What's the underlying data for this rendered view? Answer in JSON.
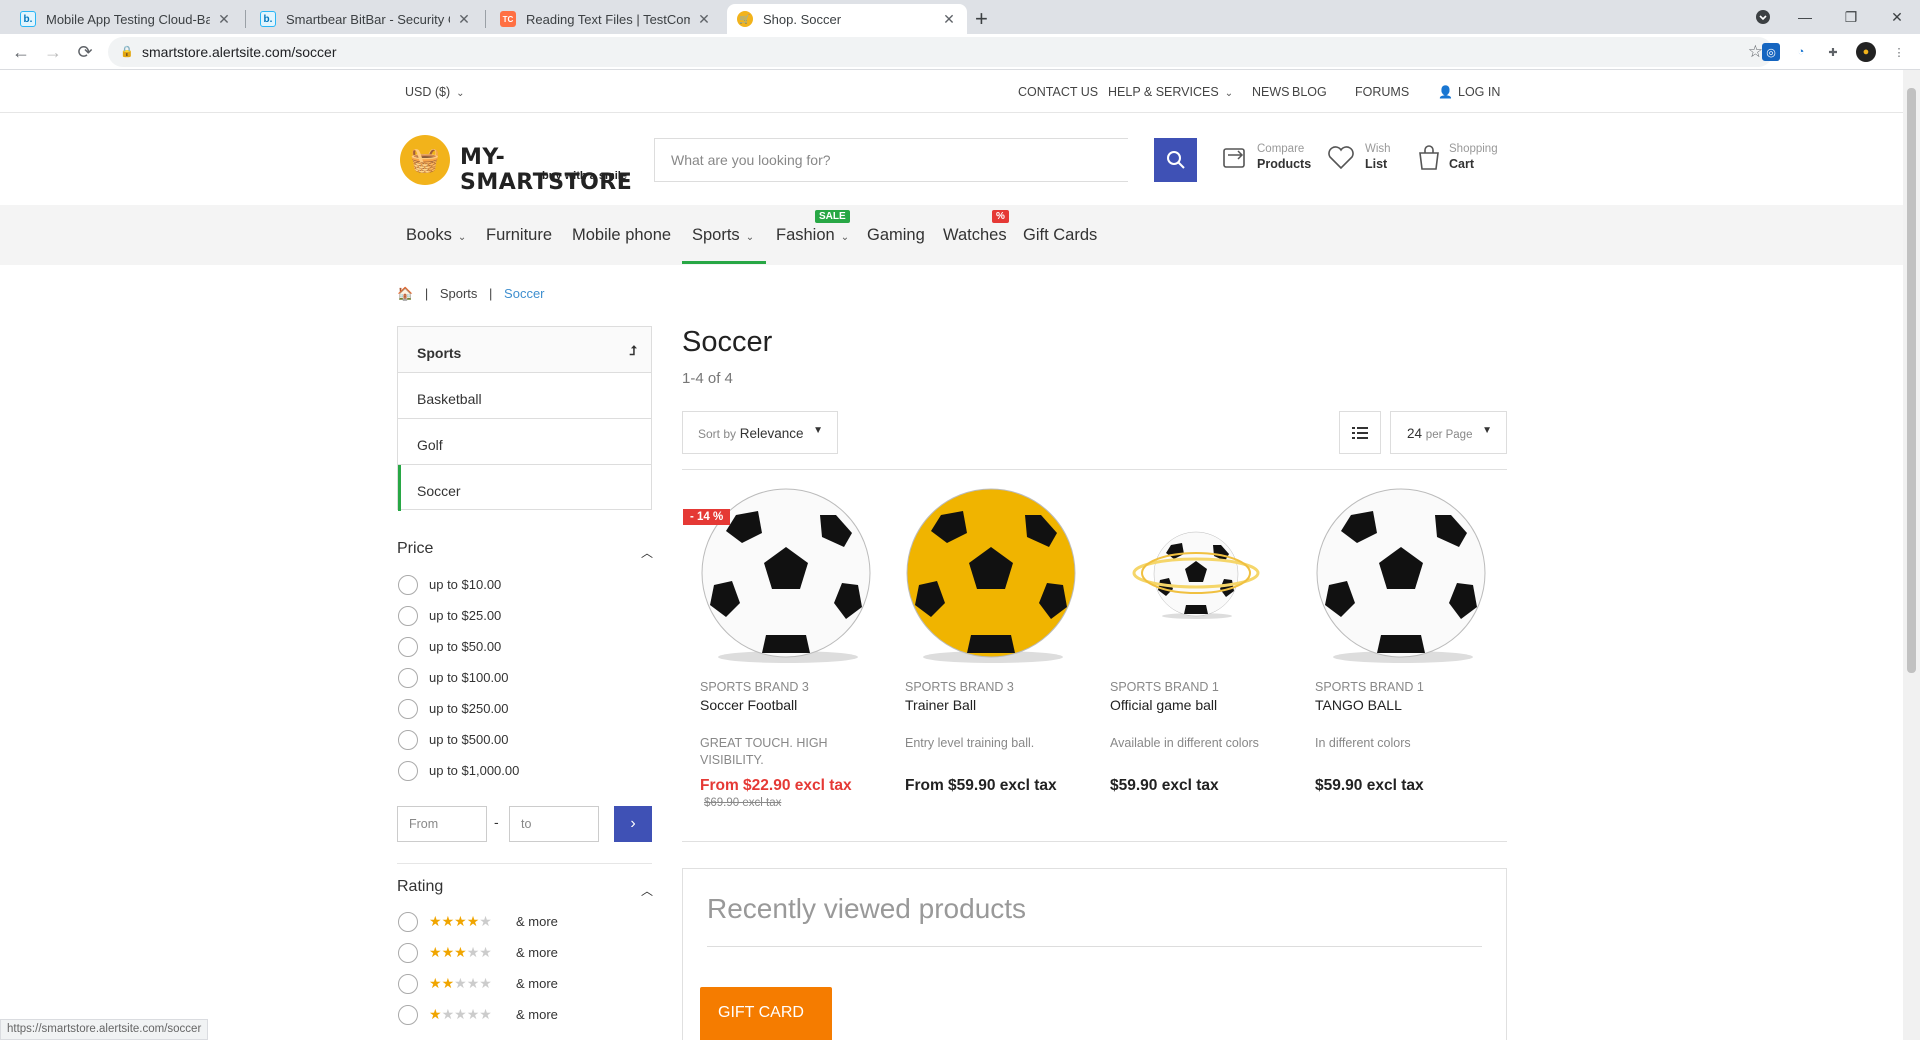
{
  "browser": {
    "tabs": [
      {
        "title": "Mobile App Testing Cloud-Based",
        "favicon": "b."
      },
      {
        "title": "Smartbear BitBar - Security Cente",
        "favicon": "b."
      },
      {
        "title": "Reading Text Files | TestComplete",
        "favicon": "TC"
      },
      {
        "title": "Shop. Soccer",
        "favicon": "cart"
      }
    ],
    "url": "smartstore.alertsite.com/soccer",
    "status_url": "https://smartstore.alertsite.com/soccer"
  },
  "topbar": {
    "currency": "USD ($)",
    "contact": "CONTACT US",
    "help": "HELP & SERVICES",
    "news": "NEWS",
    "blog": "BLOG",
    "forums": "FORUMS",
    "login": "LOG IN"
  },
  "header": {
    "logo_name": "MY-SMARTSTORE",
    "logo_tagline": "buy with a smile",
    "search_placeholder": "What are you looking for?",
    "compare_l1": "Compare",
    "compare_l2": "Products",
    "wish_l1": "Wish",
    "wish_l2": "List",
    "cart_l1": "Shopping",
    "cart_l2": "Cart"
  },
  "menu": {
    "books": "Books",
    "furniture": "Furniture",
    "mobile": "Mobile phone",
    "sports": "Sports",
    "fashion": "Fashion",
    "fashion_badge": "SALE",
    "gaming": "Gaming",
    "watches": "Watches",
    "watches_badge": "%",
    "gift": "Gift Cards"
  },
  "breadcrumb": {
    "sep": "|",
    "sports": "Sports",
    "current": "Soccer"
  },
  "categories": {
    "parent": "Sports",
    "items": [
      "Basketball",
      "Golf",
      "Soccer"
    ]
  },
  "price_filter": {
    "title": "Price",
    "options": [
      "up to $10.00",
      "up to $25.00",
      "up to $50.00",
      "up to $100.00",
      "up to $250.00",
      "up to $500.00",
      "up to $1,000.00"
    ],
    "from_placeholder": "From",
    "to_placeholder": "to",
    "dash": "-"
  },
  "rating_filter": {
    "title": "Rating",
    "options": [
      {
        "stars": 4,
        "label": "& more"
      },
      {
        "stars": 3,
        "label": "& more"
      },
      {
        "stars": 2,
        "label": "& more"
      },
      {
        "stars": 1,
        "label": "& more"
      }
    ]
  },
  "listing": {
    "title": "Soccer",
    "count": "1-4 of 4",
    "sort_prefix": "Sort by",
    "sort_value": "Relevance",
    "page_size": "24",
    "page_suffix": "per Page"
  },
  "products": [
    {
      "brand": "SPORTS BRAND 3",
      "name": "Soccer Football",
      "desc": "GREAT TOUCH. HIGH VISIBILITY.",
      "price": "From $22.90 excl tax",
      "old_price": "$69.90 excl tax",
      "discount": "- 14 %"
    },
    {
      "brand": "SPORTS BRAND 3",
      "name": "Trainer Ball",
      "desc": "Entry level training ball.",
      "price": "From $59.90 excl tax"
    },
    {
      "brand": "SPORTS BRAND 1",
      "name": "Official game ball",
      "desc": "Available in different colors",
      "price": "$59.90 excl tax"
    },
    {
      "brand": "SPORTS BRAND 1",
      "name": "TANGO BALL",
      "desc": "In different colors",
      "price": "$59.90 excl tax"
    }
  ],
  "recent": {
    "title": "Recently viewed products",
    "giftcard": "GIFT CARD"
  },
  "colors": {
    "accent": "#3f51b5",
    "active": "#28a745",
    "sale": "#e53935",
    "star": "#f0a500"
  }
}
